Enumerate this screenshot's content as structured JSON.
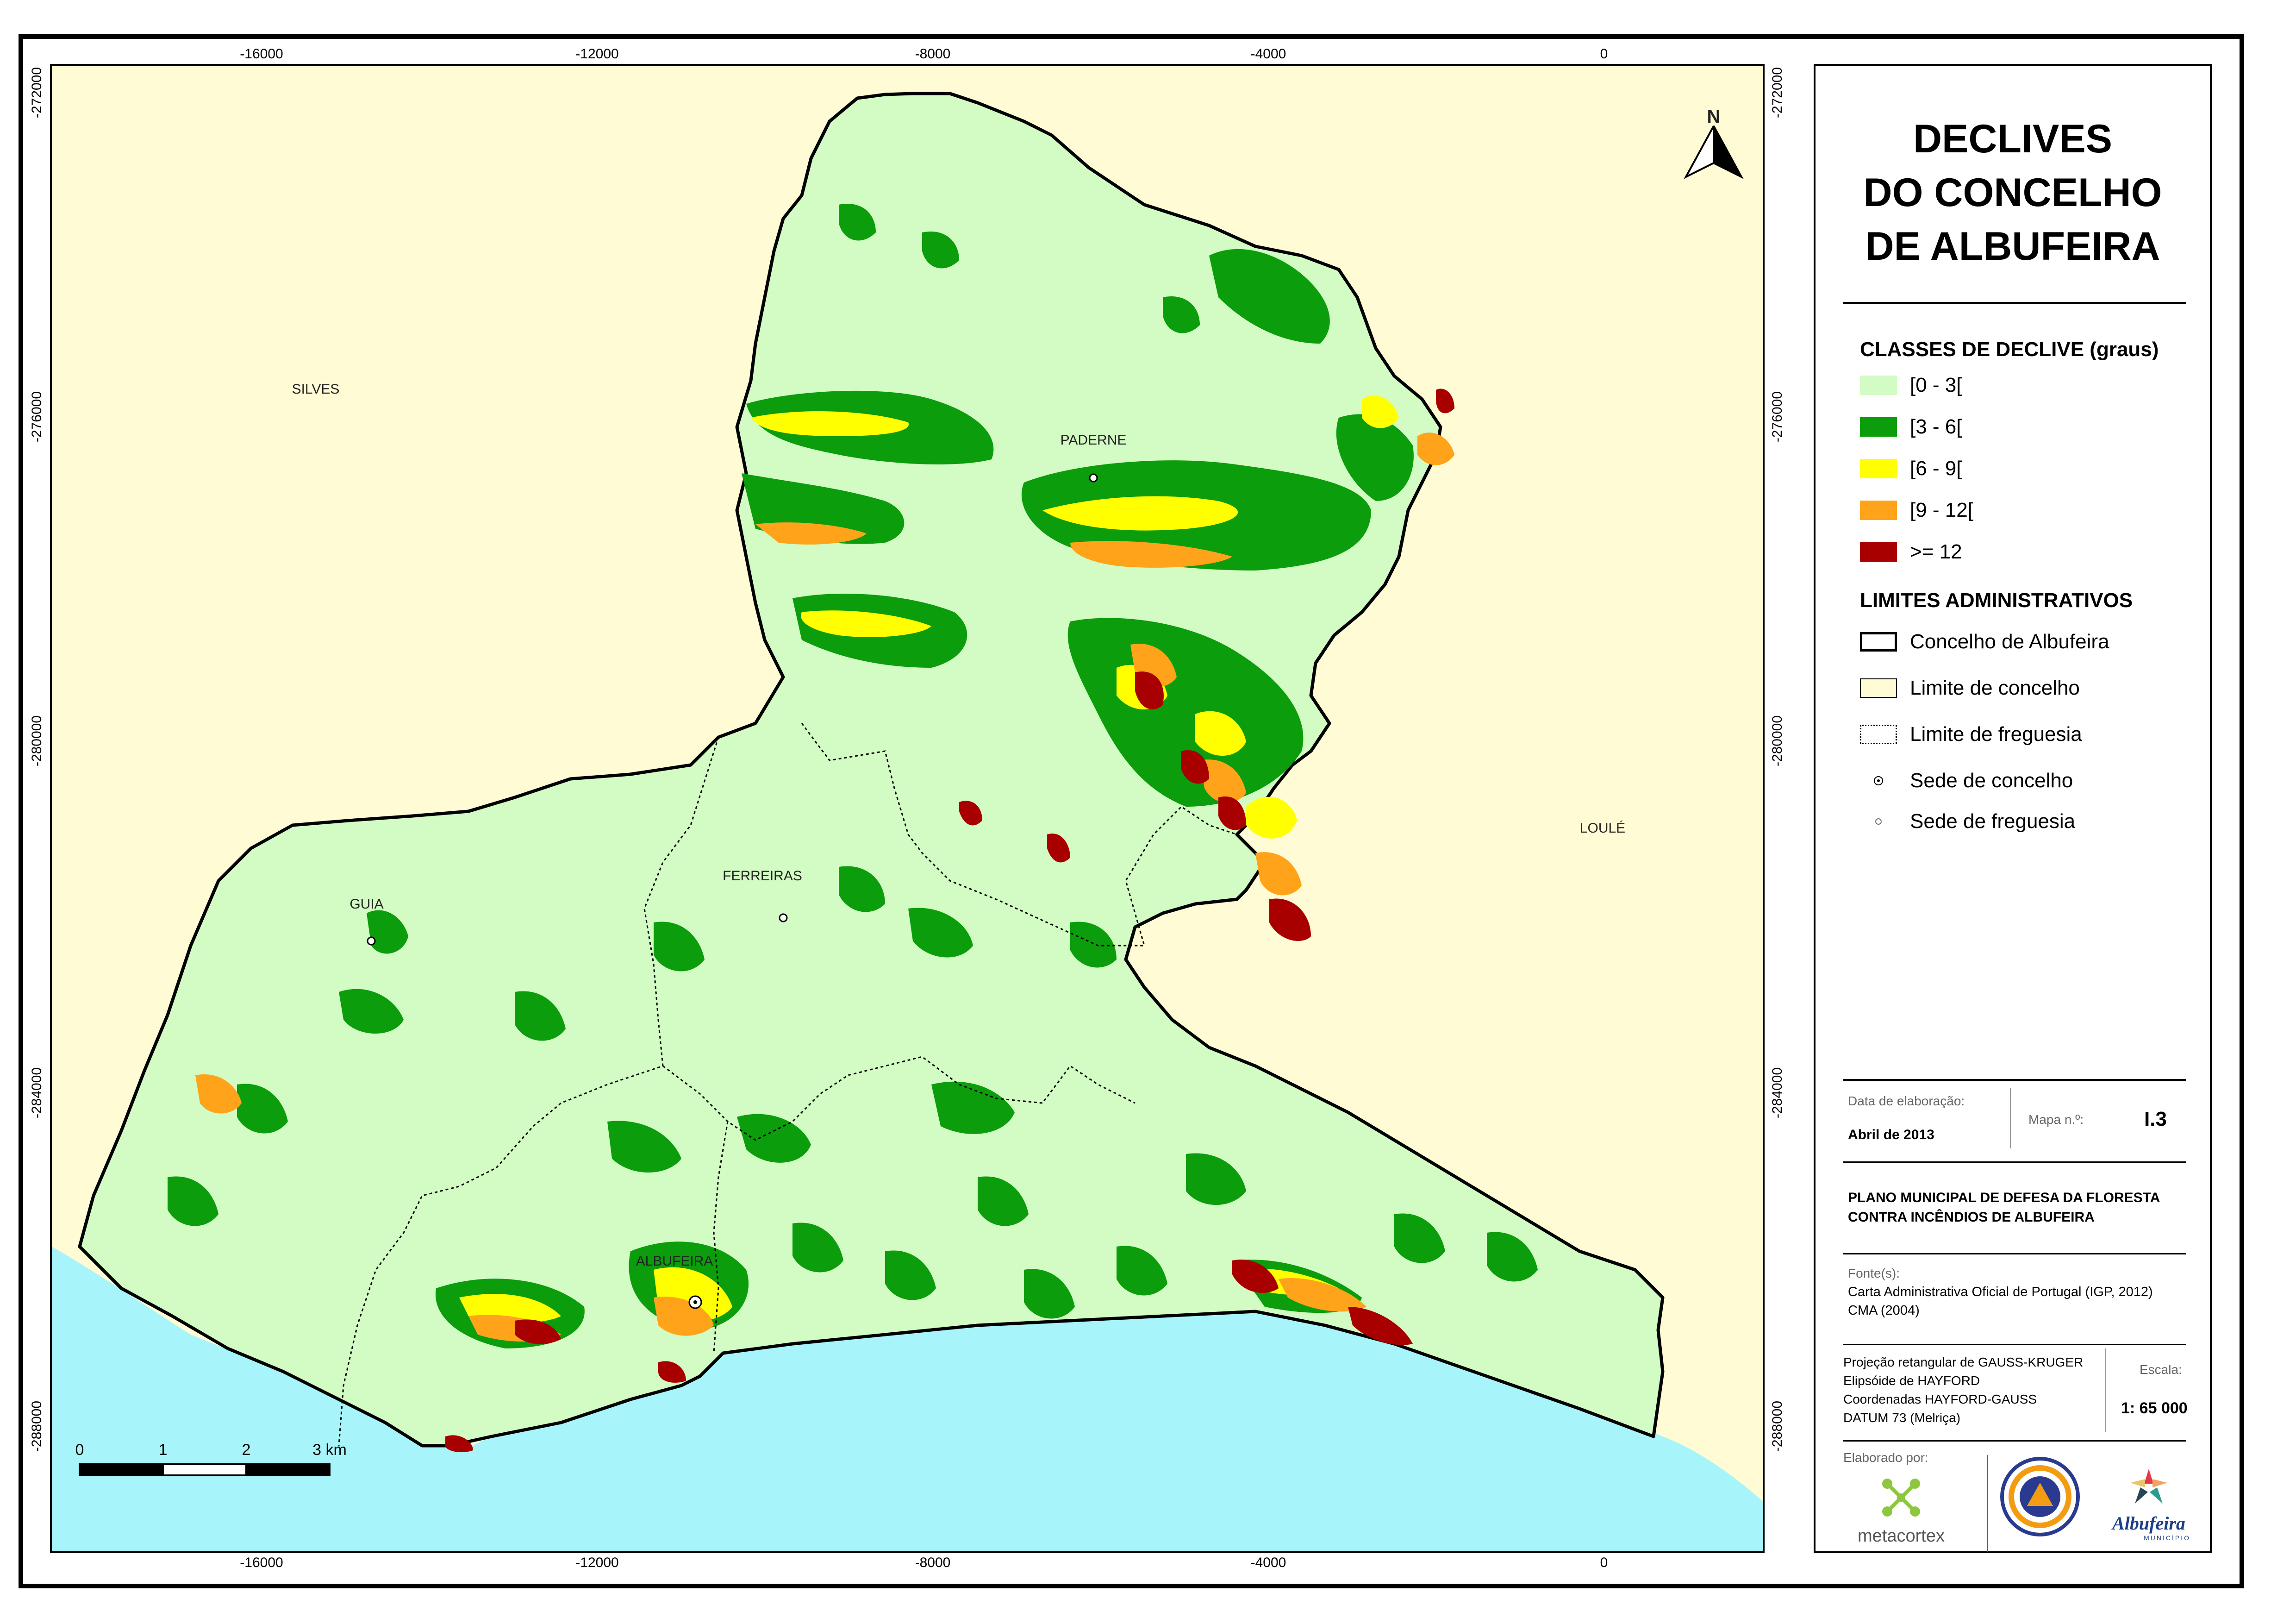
{
  "map": {
    "top_ticks": [
      "-16000",
      "-12000",
      "-8000",
      "-4000",
      "0"
    ],
    "bottom_ticks": [
      "-16000",
      "-12000",
      "-8000",
      "-4000",
      "0"
    ],
    "left_ticks": [
      "-272000",
      "-276000",
      "-280000",
      "-284000",
      "-288000"
    ],
    "right_ticks": [
      "-272000",
      "-276000",
      "-280000",
      "-284000",
      "-288000"
    ],
    "places": {
      "silves": "SILVES",
      "loule": "LOULÉ",
      "paderne": "PADERNE",
      "ferreiras": "FERREIRAS",
      "guia": "GUIA",
      "albufeira": "ALBUFEIRA"
    },
    "north_label": "N",
    "scale_bar": {
      "labels": [
        "0",
        "1",
        "2",
        "3 km"
      ]
    },
    "colors": {
      "outside": "#fffbd4",
      "sea": "#a7f5fb",
      "class_0_3": "#d3fbc4",
      "class_3_6": "#0b9d0b",
      "class_6_9": "#ffff00",
      "class_9_12": "#ffa31a",
      "class_12": "#a80000"
    }
  },
  "legend": {
    "title_lines": [
      "DECLIVES",
      "DO CONCELHO",
      "DE ALBUFEIRA"
    ],
    "classes_heading": "CLASSES DE DECLIVE (graus)",
    "classes": [
      {
        "label": "[0 - 3[",
        "color": "#d3fbc4"
      },
      {
        "label": "[3 - 6[",
        "color": "#0b9d0b"
      },
      {
        "label": "[6 - 9[",
        "color": "#ffff00"
      },
      {
        "label": "[9 - 12[",
        "color": "#ffa31a"
      },
      {
        "label": ">= 12",
        "color": "#a80000"
      }
    ],
    "limits_heading": "LIMITES ADMINISTRATIVOS",
    "limits": [
      {
        "label": "Concelho de Albufeira",
        "symbol": "black-outline-box"
      },
      {
        "label": "Limite de concelho",
        "symbol": "yellow-fill-box"
      },
      {
        "label": "Limite de freguesia",
        "symbol": "dotted-box"
      },
      {
        "label": "Sede de concelho",
        "symbol": "dot-in-circle-icon"
      },
      {
        "label": "Sede de freguesia",
        "symbol": "small-circle-icon"
      }
    ]
  },
  "info": {
    "date_label": "Data de elaboração:",
    "date_value": "Abril de 2013",
    "map_no_label": "Mapa n.º:",
    "map_no_value": "I.3",
    "plan_lines": [
      "PLANO MUNICIPAL DE DEFESA DA FLORESTA",
      "CONTRA INCÊNDIOS DE ALBUFEIRA"
    ],
    "sources_label": "Fonte(s):",
    "sources_lines": [
      "Carta Administrativa Oficial de Portugal (IGP, 2012)",
      "CMA (2004)"
    ],
    "projection_lines": [
      "Projeção retangular de GAUSS-KRUGER",
      "Elipsóide de HAYFORD",
      "Coordenadas HAYFORD-GAUSS",
      "DATUM 73 (Melriça)"
    ],
    "scale_label": "Escala:",
    "scale_value": "1: 65 000",
    "made_by_label": "Elaborado por:",
    "logos": {
      "metacortex": "metacortex",
      "albufeira": "Albufeira",
      "albufeira_sub": "MUNICÍPIO"
    }
  }
}
